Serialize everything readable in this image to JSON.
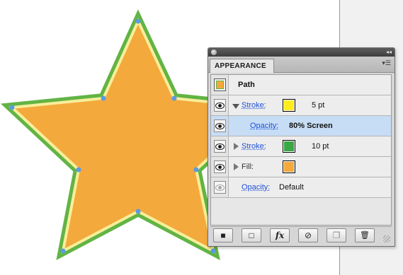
{
  "panel": {
    "tab_label": "APPEARANCE",
    "collapse_glyph": "◂◂",
    "menu_glyph": "▾☰"
  },
  "rows": [
    {
      "type": "path",
      "label": "Path"
    },
    {
      "type": "stroke",
      "label": "Stroke:",
      "value": "5 pt",
      "swatch_color": "#ffec1c",
      "expanded": true
    },
    {
      "type": "opacity",
      "label": "Opacity:",
      "value": "80% Screen",
      "selected": true
    },
    {
      "type": "stroke",
      "label": "Stroke:",
      "value": "10 pt",
      "swatch_color": "#3aa845",
      "expanded": false
    },
    {
      "type": "fill",
      "label": "Fill:",
      "swatch_color": "#f3a93b",
      "expanded": false
    },
    {
      "type": "opacity",
      "label": "Opacity:",
      "value": "Default"
    }
  ],
  "toolbar": {
    "new_art_basic": "■",
    "new_art_no_appearance": "□",
    "add_effect": "fx",
    "clear_appearance": "⊘",
    "duplicate_item": "❐",
    "delete_item": "🗑"
  },
  "artwork": {
    "fill_color": "#f3a93b",
    "outer_stroke_color": "#62b444",
    "inner_stroke_color": "#f7ee9a",
    "anchor_color": "#5b9be3"
  }
}
